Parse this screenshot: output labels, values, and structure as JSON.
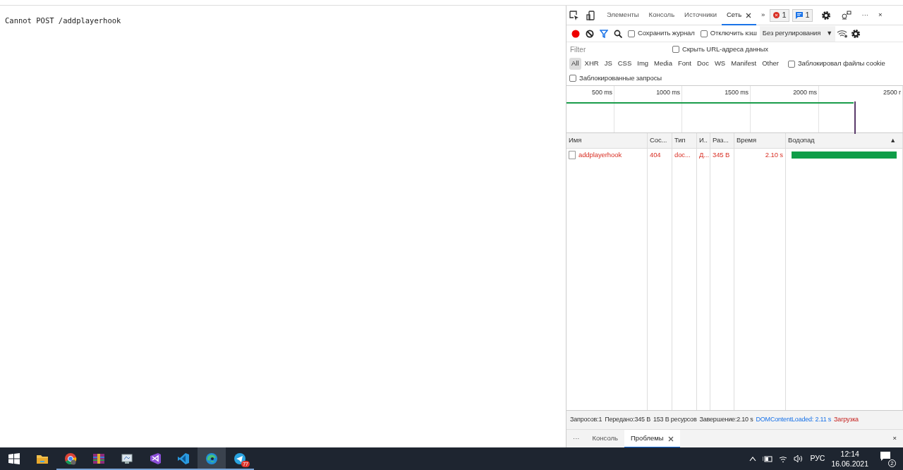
{
  "page": {
    "text": "Cannot POST /addplayerhook"
  },
  "devtools": {
    "tabs": [
      {
        "label": "Элементы",
        "selected": false
      },
      {
        "label": "Консоль",
        "selected": false
      },
      {
        "label": "Источники",
        "selected": false
      },
      {
        "label": "Сеть",
        "selected": true,
        "closable": true
      }
    ],
    "more_tabs": "»",
    "errors": "1",
    "messages": "1",
    "more_menu": "···",
    "close": "×",
    "toolbar": {
      "recording": true,
      "filter_active": true,
      "checkboxes": [
        {
          "label": "Сохранить журнал",
          "checked": false
        },
        {
          "label": "Отключить кэш",
          "checked": false
        }
      ],
      "throttling": "Без регулирования",
      "throttling_caret": "▼"
    },
    "filter": {
      "placeholder": "Filter",
      "hide_data_urls": {
        "label": "Скрыть URL-адреса данных",
        "checked": false
      }
    },
    "types": [
      {
        "label": "All",
        "selected": true
      },
      {
        "label": "XHR",
        "selected": false
      },
      {
        "label": "JS",
        "selected": false
      },
      {
        "label": "CSS",
        "selected": false
      },
      {
        "label": "Img",
        "selected": false
      },
      {
        "label": "Media",
        "selected": false
      },
      {
        "label": "Font",
        "selected": false
      },
      {
        "label": "Doc",
        "selected": false
      },
      {
        "label": "WS",
        "selected": false
      },
      {
        "label": "Manifest",
        "selected": false
      },
      {
        "label": "Other",
        "selected": false
      }
    ],
    "blocked_cookies": {
      "label": "Заблокировал файлы cookie",
      "checked": false
    },
    "blocked_requests": {
      "label": "Заблокированные запросы",
      "checked": false
    },
    "overview": {
      "ticks": [
        "500 ms",
        "1000 ms",
        "1500 ms",
        "2000 ms",
        "2500 r"
      ]
    },
    "table": {
      "columns": [
        "Имя",
        "Сос...",
        "Тип",
        "И..",
        "Раз...",
        "Время",
        "Водопад"
      ],
      "sort_icon": "▲",
      "rows": [
        {
          "name": "addplayerhook",
          "status": "404",
          "type": "doc...",
          "initiator": "Д...",
          "size": "345 B",
          "time": "2.10 s",
          "failed": true
        }
      ]
    },
    "status_bar": [
      {
        "text": "Запросов:1",
        "kind": "plain"
      },
      {
        "text": "Передано:345 B",
        "kind": "plain"
      },
      {
        "text": "153 B ресурсов",
        "kind": "plain"
      },
      {
        "text": "Завершение:2.10 s",
        "kind": "plain"
      },
      {
        "text": "DOMContentLoaded: 2.11 s",
        "kind": "dcl"
      },
      {
        "text": "Загрузка",
        "kind": "load"
      }
    ],
    "drawer": {
      "more": "···",
      "tabs": [
        {
          "label": "Консоль",
          "selected": false
        },
        {
          "label": "Проблемы",
          "selected": true,
          "closable": true
        }
      ],
      "close": "×"
    }
  },
  "taskbar": {
    "apps": [
      {
        "running": false,
        "selected": false
      },
      {
        "running": true,
        "selected": false
      },
      {
        "running": true,
        "selected": false
      },
      {
        "running": true,
        "selected": false
      },
      {
        "running": true,
        "selected": false
      },
      {
        "running": true,
        "selected": false
      },
      {
        "running": true,
        "selected": true
      },
      {
        "running": true,
        "selected": false,
        "badge": "77"
      }
    ],
    "tray": {
      "language": "РУС",
      "time": "12:14",
      "date": "16.06.2021",
      "notifications": "2"
    }
  }
}
